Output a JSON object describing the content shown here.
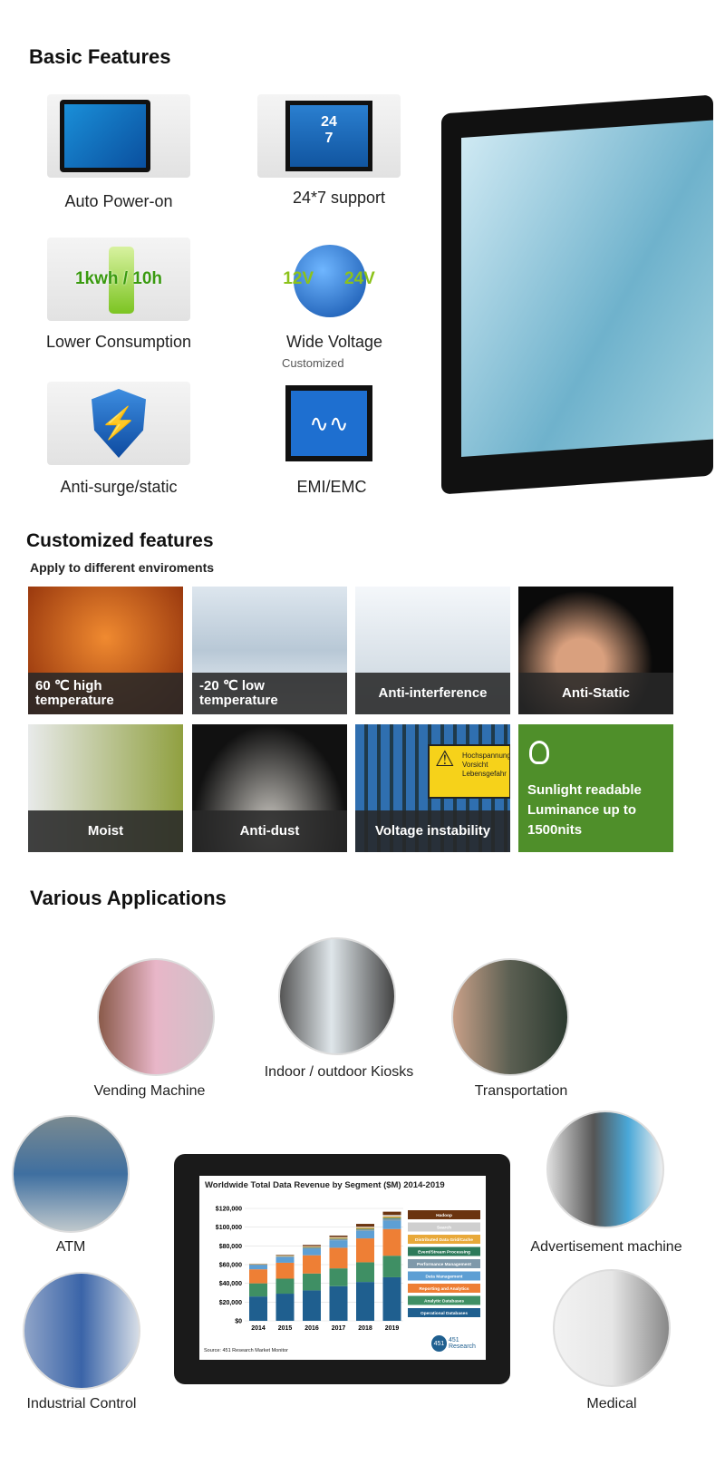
{
  "basic": {
    "title": "Basic Features",
    "items": [
      {
        "label": "Auto Power-on",
        "icon": "monitor-plug-icon"
      },
      {
        "label": "24*7 support",
        "icon": "clock-24-7-icon",
        "badge_top": "24",
        "badge_bottom": "7"
      },
      {
        "label": "Lower Consumption",
        "icon": "battery-icon",
        "badge": "1kwh / 10h"
      },
      {
        "label": "Wide Voltage",
        "sub": "Customized",
        "icon": "lightning-globe-icon",
        "v1": "12V",
        "v2": "24V"
      },
      {
        "label": "Anti-surge/static",
        "icon": "shield-lightning-icon"
      },
      {
        "label": "EMI/EMC",
        "icon": "waveform-monitor-icon"
      }
    ]
  },
  "custom": {
    "title": "Customized features",
    "subtitle": "Apply to different enviroments",
    "items": [
      {
        "label": "60 ℃ high temperature"
      },
      {
        "label": "-20 ℃ low temperature"
      },
      {
        "label": "Anti-interference"
      },
      {
        "label": "Anti-Static"
      },
      {
        "label": "Moist"
      },
      {
        "label": "Anti-dust"
      },
      {
        "label": "Voltage instability",
        "sign": "Hochspannung Vorsicht Lebensgefahr"
      },
      {
        "label": "Sunlight readable Luminance up to 1500nits",
        "color": "#4f8f2a"
      }
    ]
  },
  "apps": {
    "title": "Various Applications",
    "items": [
      "Vending Machine",
      "Indoor / outdoor Kiosks",
      "Transportation",
      "ATM",
      "Advertisement machine",
      "Industrial Control",
      "Medical"
    ]
  },
  "chart_data": {
    "type": "bar",
    "stacked": true,
    "title": "Worldwide Total Data Revenue by Segment ($M) 2014-2019",
    "categories": [
      "2014",
      "2015",
      "2016",
      "2017",
      "2018",
      "2019"
    ],
    "ylim": [
      0,
      120000
    ],
    "yticks": [
      "$0",
      "$20,000",
      "$40,000",
      "$60,000",
      "$80,000",
      "$100,000",
      "$120,000"
    ],
    "legend": "right",
    "source": "Source: 451 Research Market Monitor",
    "logo": "451 Research",
    "series": [
      {
        "name": "Operational Databases",
        "color": "#1f5f8f",
        "values": [
          26000,
          29000,
          32500,
          37000,
          41500,
          46500
        ]
      },
      {
        "name": "Analytic Databases",
        "color": "#3f8f64",
        "values": [
          14000,
          16000,
          18000,
          19000,
          21000,
          23000
        ]
      },
      {
        "name": "Reporting and Analytics",
        "color": "#ee7f35",
        "values": [
          15000,
          17000,
          19500,
          22000,
          25500,
          28500
        ]
      },
      {
        "name": "Data Management",
        "color": "#5e9fd4",
        "values": [
          4500,
          6000,
          7000,
          8000,
          8000,
          9000
        ]
      },
      {
        "name": "Performance Management",
        "color": "#7f99aa",
        "values": [
          500,
          700,
          1000,
          1200,
          1500,
          2000
        ]
      },
      {
        "name": "Event/Stream Processing",
        "color": "#2c7a5a",
        "values": [
          200,
          300,
          400,
          500,
          700,
          1000
        ]
      },
      {
        "name": "Distributed Data Grid/Cache",
        "color": "#e8a93a",
        "values": [
          300,
          500,
          700,
          1000,
          1300,
          1500
        ]
      },
      {
        "name": "Search",
        "color": "#cfcfcf",
        "values": [
          300,
          400,
          600,
          800,
          1000,
          1500
        ]
      },
      {
        "name": "Hadoop",
        "color": "#6b3410",
        "values": [
          200,
          600,
          1300,
          1500,
          3000,
          3500
        ]
      }
    ]
  }
}
